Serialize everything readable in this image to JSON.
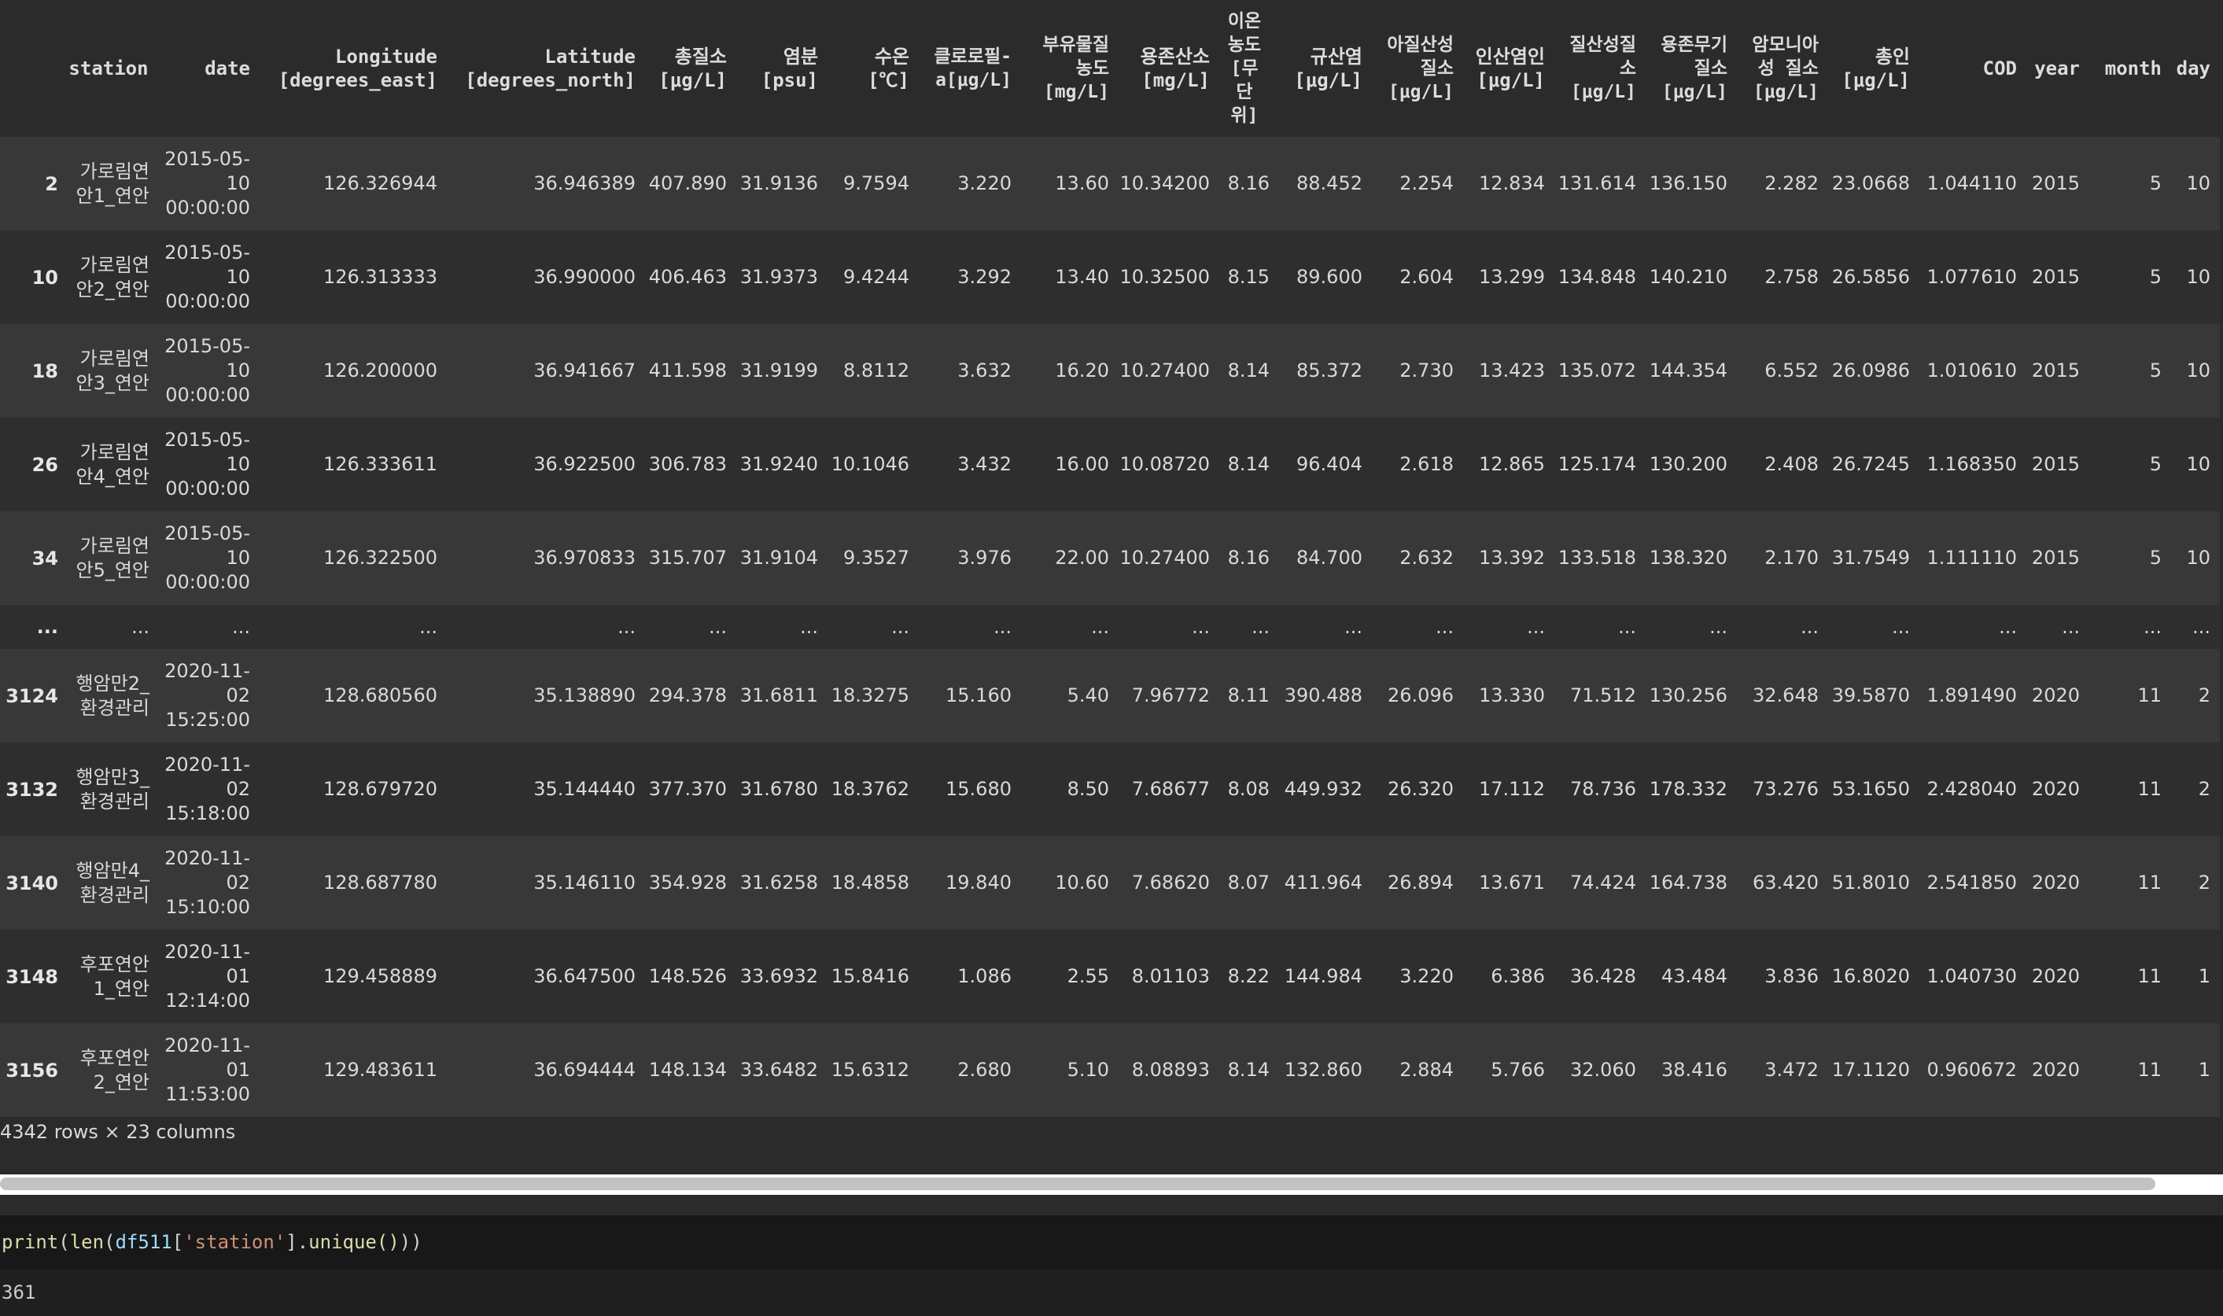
{
  "dataframe": {
    "columns": [
      "station",
      "date",
      "Longitude [degrees_east]",
      "Latitude [degrees_north]",
      "총질소 [μg/L]",
      "염분 [psu]",
      "수온 [℃]",
      "클로로필-a[μg/L]",
      "부유물질 농도 [mg/L]",
      "용존산소 [mg/L]",
      "이온 농도 [무 단 위]",
      "규산염 [μg/L]",
      "아질산성 질소 [μg/L]",
      "인산염인 [μg/L]",
      "질산성질 소 [μg/L]",
      "용존무기 질소 [μg/L]",
      "암모니아 성 질소 [μg/L]",
      "총인 [μg/L]",
      "COD",
      "year",
      "month",
      "day"
    ],
    "rows": [
      {
        "index": "2",
        "cells": [
          "가로림연안1_연안",
          "2015-05-10 00:00:00",
          "126.326944",
          "36.946389",
          "407.890",
          "31.9136",
          "9.7594",
          "3.220",
          "13.60",
          "10.34200",
          "8.16",
          "88.452",
          "2.254",
          "12.834",
          "131.614",
          "136.150",
          "2.282",
          "23.0668",
          "1.044110",
          "2015",
          "5",
          "10"
        ]
      },
      {
        "index": "10",
        "cells": [
          "가로림연안2_연안",
          "2015-05-10 00:00:00",
          "126.313333",
          "36.990000",
          "406.463",
          "31.9373",
          "9.4244",
          "3.292",
          "13.40",
          "10.32500",
          "8.15",
          "89.600",
          "2.604",
          "13.299",
          "134.848",
          "140.210",
          "2.758",
          "26.5856",
          "1.077610",
          "2015",
          "5",
          "10"
        ]
      },
      {
        "index": "18",
        "cells": [
          "가로림연안3_연안",
          "2015-05-10 00:00:00",
          "126.200000",
          "36.941667",
          "411.598",
          "31.9199",
          "8.8112",
          "3.632",
          "16.20",
          "10.27400",
          "8.14",
          "85.372",
          "2.730",
          "13.423",
          "135.072",
          "144.354",
          "6.552",
          "26.0986",
          "1.010610",
          "2015",
          "5",
          "10"
        ]
      },
      {
        "index": "26",
        "cells": [
          "가로림연안4_연안",
          "2015-05-10 00:00:00",
          "126.333611",
          "36.922500",
          "306.783",
          "31.9240",
          "10.1046",
          "3.432",
          "16.00",
          "10.08720",
          "8.14",
          "96.404",
          "2.618",
          "12.865",
          "125.174",
          "130.200",
          "2.408",
          "26.7245",
          "1.168350",
          "2015",
          "5",
          "10"
        ]
      },
      {
        "index": "34",
        "cells": [
          "가로림연안5_연안",
          "2015-05-10 00:00:00",
          "126.322500",
          "36.970833",
          "315.707",
          "31.9104",
          "9.3527",
          "3.976",
          "22.00",
          "10.27400",
          "8.16",
          "84.700",
          "2.632",
          "13.392",
          "133.518",
          "138.320",
          "2.170",
          "31.7549",
          "1.111110",
          "2015",
          "5",
          "10"
        ]
      },
      {
        "index": "...",
        "cells": [
          "...",
          "...",
          "...",
          "...",
          "...",
          "...",
          "...",
          "...",
          "...",
          "...",
          "...",
          "...",
          "...",
          "...",
          "...",
          "...",
          "...",
          "...",
          "...",
          "...",
          "...",
          "..."
        ]
      },
      {
        "index": "3124",
        "cells": [
          "행암만2_환경관리",
          "2020-11-02 15:25:00",
          "128.680560",
          "35.138890",
          "294.378",
          "31.6811",
          "18.3275",
          "15.160",
          "5.40",
          "7.96772",
          "8.11",
          "390.488",
          "26.096",
          "13.330",
          "71.512",
          "130.256",
          "32.648",
          "39.5870",
          "1.891490",
          "2020",
          "11",
          "2"
        ]
      },
      {
        "index": "3132",
        "cells": [
          "행암만3_환경관리",
          "2020-11-02 15:18:00",
          "128.679720",
          "35.144440",
          "377.370",
          "31.6780",
          "18.3762",
          "15.680",
          "8.50",
          "7.68677",
          "8.08",
          "449.932",
          "26.320",
          "17.112",
          "78.736",
          "178.332",
          "73.276",
          "53.1650",
          "2.428040",
          "2020",
          "11",
          "2"
        ]
      },
      {
        "index": "3140",
        "cells": [
          "행암만4_환경관리",
          "2020-11-02 15:10:00",
          "128.687780",
          "35.146110",
          "354.928",
          "31.6258",
          "18.4858",
          "19.840",
          "10.60",
          "7.68620",
          "8.07",
          "411.964",
          "26.894",
          "13.671",
          "74.424",
          "164.738",
          "63.420",
          "51.8010",
          "2.541850",
          "2020",
          "11",
          "2"
        ]
      },
      {
        "index": "3148",
        "cells": [
          "후포연안1_연안",
          "2020-11-01 12:14:00",
          "129.458889",
          "36.647500",
          "148.526",
          "33.6932",
          "15.8416",
          "1.086",
          "2.55",
          "8.01103",
          "8.22",
          "144.984",
          "3.220",
          "6.386",
          "36.428",
          "43.484",
          "3.836",
          "16.8020",
          "1.040730",
          "2020",
          "11",
          "1"
        ]
      },
      {
        "index": "3156",
        "cells": [
          "후포연안2_연안",
          "2020-11-01 11:53:00",
          "129.483611",
          "36.694444",
          "148.134",
          "33.6482",
          "15.6312",
          "2.680",
          "5.10",
          "8.08893",
          "8.14",
          "132.860",
          "2.884",
          "5.766",
          "32.060",
          "38.416",
          "3.472",
          "17.1120",
          "0.960672",
          "2020",
          "11",
          "1"
        ]
      }
    ],
    "summary": "4342 rows × 23 columns"
  },
  "code_cell": {
    "fn_print": "print",
    "fn_len": "len",
    "var_df": "df511",
    "str_col": "'station'",
    "method": ".unique()",
    "source": "print(len(df511['station'].unique()))"
  },
  "output": {
    "text": "361"
  },
  "colors": {
    "background": "#2b2b2b",
    "row_odd": "#383838",
    "row_even": "#2e2e2e",
    "code_bg": "#181818",
    "string": "#ce9178"
  }
}
